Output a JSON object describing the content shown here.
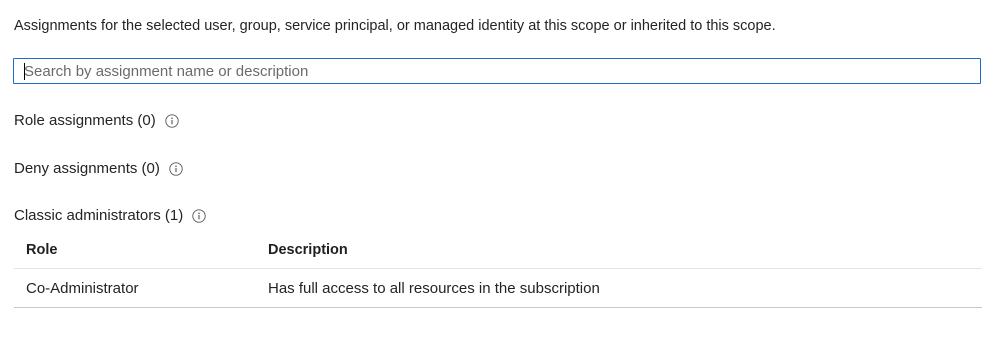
{
  "intro_text": "Assignments for the selected user, group, service principal, or managed identity at this scope or inherited to this scope.",
  "search": {
    "placeholder": "Search by assignment name or description",
    "value": ""
  },
  "sections": {
    "role_assignments": "Role assignments (0)",
    "deny_assignments": "Deny assignments (0)",
    "classic_administrators": "Classic administrators (1)"
  },
  "info_icon": "info-circle-icon",
  "classic_table": {
    "headers": {
      "role": "Role",
      "description": "Description"
    },
    "rows": [
      {
        "role": "Co-Administrator",
        "description": "Has full access to all resources in the subscription"
      }
    ]
  },
  "colors": {
    "search_border": "#1b6ec2",
    "text": "#242424",
    "divider": "#e3e3e3"
  }
}
